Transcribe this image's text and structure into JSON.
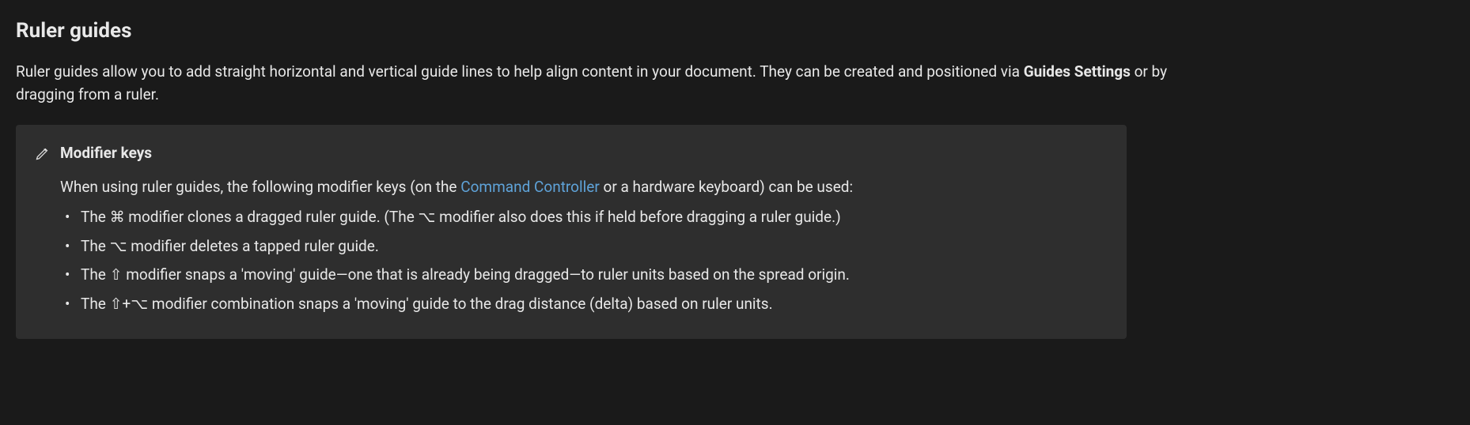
{
  "heading": "Ruler guides",
  "intro": {
    "part1": "Ruler guides allow you to add straight horizontal and vertical guide lines to help align content in your document. They can be created and positioned via ",
    "strong1": "Guides Settings",
    "part2": " or by dragging from a ruler."
  },
  "callout": {
    "icon_name": "pencil-icon",
    "title": "Modifier keys",
    "lead": {
      "part1": "When using ruler guides, the following modifier keys (on the ",
      "link_text": "Command Controller",
      "part2": " or a hardware keyboard) can be used:"
    },
    "items": [
      {
        "pre": "The ",
        "key1": "⌘",
        "mid": " modifier clones a dragged ruler guide. (The ",
        "key2": "⌥",
        "post": " modifier also does this if held before dragging a ruler guide.)"
      },
      {
        "pre": "The ",
        "key1": "⌥",
        "post": " modifier deletes a tapped ruler guide."
      },
      {
        "pre": "The ",
        "key1": "⇧",
        "post": " modifier snaps a 'moving' guide—one that is already being dragged—to ruler units based on the spread origin."
      },
      {
        "pre": "The ",
        "key1": "⇧",
        "plus": "+",
        "key2": "⌥",
        "post": " modifier combination snaps a 'moving' guide to the drag distance (delta) based on ruler units."
      }
    ]
  }
}
